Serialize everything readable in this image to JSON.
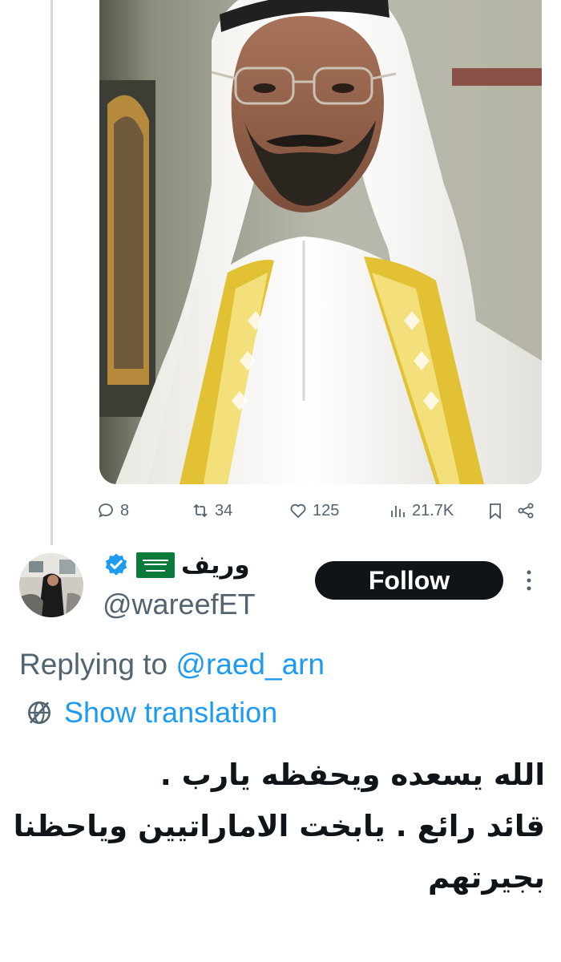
{
  "post": {
    "actions": {
      "replies": "8",
      "reposts": "34",
      "likes": "125",
      "views": "21.7K"
    }
  },
  "reply": {
    "author": {
      "name": "وريف",
      "flag": "🇸🇦",
      "verified": true,
      "handle": "@wareefET"
    },
    "follow_label": "Follow",
    "replying_prefix": "Replying to",
    "replying_to": "@raed_arn",
    "show_translation": "Show translation",
    "text_lines": [
      "الله يسعده ويحفظه يارب .",
      "قائد رائع . يابخت الاماراتيين وياحظنا",
      "بجيرتهم"
    ]
  },
  "colors": {
    "accent": "#1d9bf0",
    "text_primary": "#0f1419",
    "text_secondary": "#536471",
    "follow_bg": "#0f1419",
    "thread_line": "#cfd9de"
  },
  "icons": {
    "reply": "reply-icon",
    "repost": "repost-icon",
    "like": "heart-icon",
    "views": "views-icon",
    "bookmark": "bookmark-icon",
    "share": "share-icon",
    "verified": "verified-badge-icon",
    "more": "more-vertical-icon",
    "translate": "globe-icon"
  }
}
